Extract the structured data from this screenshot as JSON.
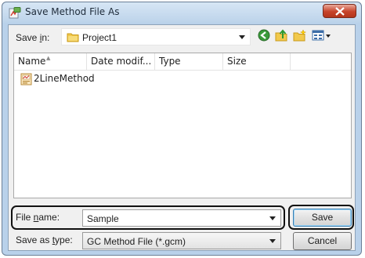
{
  "window": {
    "title": "Save Method File As",
    "close_icon": "close-x-icon"
  },
  "save_in": {
    "label_pre": "Save ",
    "label_accel": "i",
    "label_post": "n:",
    "value": "Project1"
  },
  "toolbar": {
    "icons": [
      "back-icon",
      "up-folder-icon",
      "new-folder-icon",
      "views-menu-icon"
    ]
  },
  "list": {
    "columns": [
      "Name",
      "Date modif...",
      "Type",
      "Size"
    ],
    "items": [
      {
        "name": "2LineMethod",
        "icon": "method-file-icon"
      }
    ]
  },
  "file_name": {
    "label_pre": "File ",
    "label_accel": "n",
    "label_post": "ame:",
    "value": "Sample"
  },
  "save_as_type": {
    "label_pre": "Save as ",
    "label_accel": "t",
    "label_post": "ype:",
    "value": "GC Method File (*.gcm)"
  },
  "buttons": {
    "save": "Save",
    "cancel": "Cancel"
  },
  "colors": {
    "frame": "#b9d1ea",
    "client": "#f0f0f0",
    "close_button": "#c7432a",
    "highlight_outline": "#111111"
  }
}
